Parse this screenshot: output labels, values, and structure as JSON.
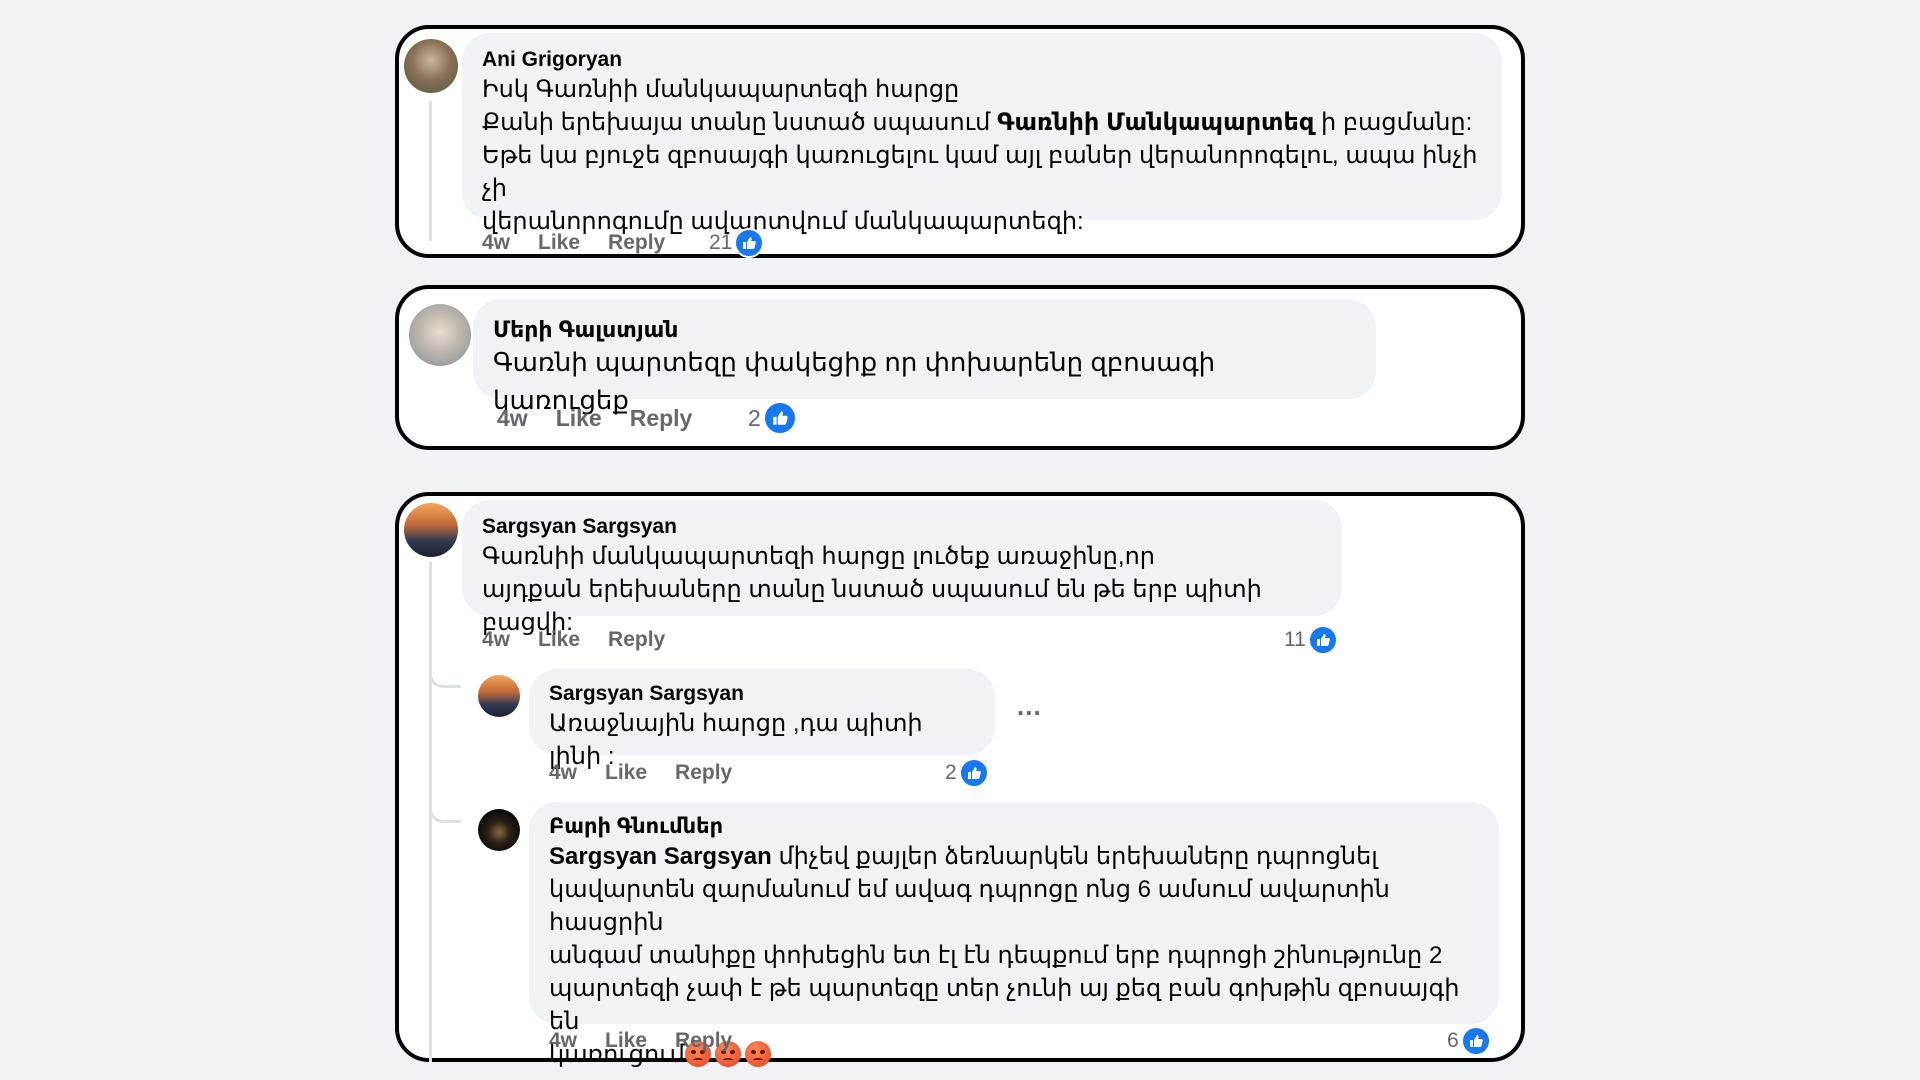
{
  "labels": {
    "like": "Like",
    "reply": "Reply"
  },
  "colors": {
    "like_blue": "#1877f2",
    "meta_gray": "#65676b",
    "bubble_gray": "#f0f2f5"
  },
  "comments": [
    {
      "author": "Ani Grigoryan",
      "line1": "Իսկ Գառնիի մանկապարտեզի հարցը",
      "line2_pre": "Քանի երեխայա տանը նստած սպասում ",
      "line2_bold": "Գառնիի Մանկապարտեզ",
      "line2_post": " ի բացմանը:",
      "line3": "Եթե կա բյուջե զբոսայգի կառուցելու կամ այլ բաներ վերանորոգելու, ապա ինչի չի",
      "line4": "վերանորոգումը ավարտվում մանկապարտեզի:",
      "time": "4w",
      "likes": "21"
    },
    {
      "author": "Մերի Գալստյան",
      "line1": "Գառնի պարտեզը փակեցիք որ փոխարենը զբոսագի կառուցեք",
      "time": "4w",
      "likes": "2"
    },
    {
      "author": "Sargsyan Sargsyan",
      "line1": "Գառնիի մանկապարտեզի հարցը լուծեք առաջինը,որ",
      "line2": "այդքան երեխաները տանը նստած սպասում են թե երբ պիտի բացվի:",
      "time": "4w",
      "likes": "11",
      "replies": [
        {
          "author": "Sargsyan Sargsyan",
          "line1": "Առաջնային հարցը ,դա պիտի լինի :",
          "time": "4w",
          "likes": "2",
          "more": "..."
        },
        {
          "author": "Բարի Գնումներ",
          "mention": "Sargsyan Sargsyan",
          "line1_post": " միչեվ քայլեր ձեռնարկեն երեխաները դպրոցնել",
          "line2": "կավարտեն զարմանում եմ ավագ դպրոցը ոնց 6 ամսում ավարտին հասցրին",
          "line3": "անգամ տանիքը փոխեցին ետ էլ էն դեպքում երբ դպրոցի շինությունը 2",
          "line4": "պարտեզի չափ է թե պարտեզը տեր չունի այ քեզ բան գոխթին զբոսայգի են",
          "line5": "կառուցում",
          "emoji": "angry-face-icon",
          "time": "4w",
          "likes": "6"
        }
      ]
    }
  ]
}
